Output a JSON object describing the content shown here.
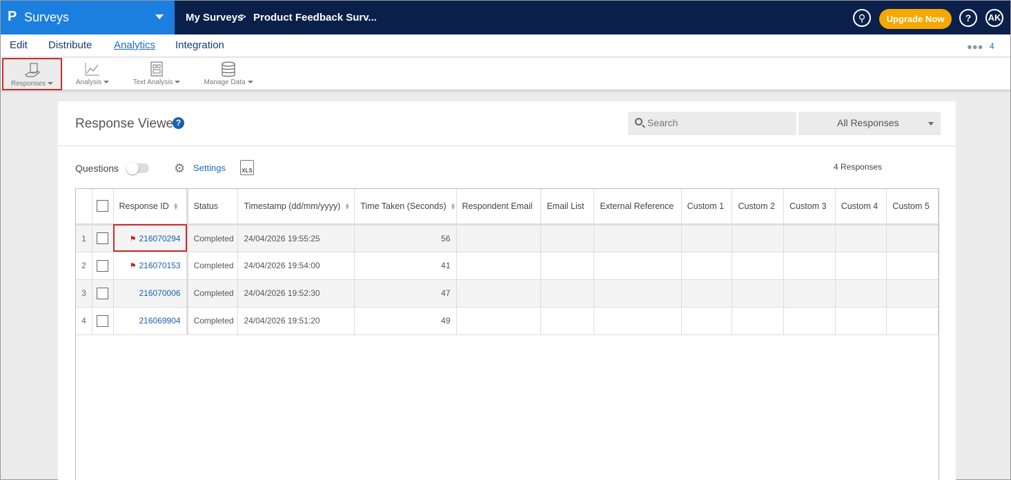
{
  "brand": {
    "logo": "P",
    "name": "Surveys"
  },
  "breadcrumb": {
    "root": "My Surveys",
    "separator": ">",
    "current": "Product Feedback Surv..."
  },
  "header": {
    "search_glyph": "⚲",
    "upgrade_label": "Upgrade Now",
    "help_glyph": "?",
    "avatar_initials": "AK"
  },
  "nav": {
    "tabs": [
      "Edit",
      "Distribute",
      "Analytics",
      "Integration"
    ],
    "active": "Analytics",
    "collaborators_count": "4"
  },
  "ribbon": {
    "tools": [
      {
        "label": "Responses",
        "icon": "hand-document-icon",
        "selected": true
      },
      {
        "label": "Analysis",
        "icon": "line-chart-icon",
        "selected": false
      },
      {
        "label": "Text Analysis",
        "icon": "text-analysis-icon",
        "selected": false
      },
      {
        "label": "Manage Data",
        "icon": "database-icon",
        "selected": false
      }
    ]
  },
  "viewer": {
    "title": "Response Viewer",
    "help": "?",
    "search_placeholder": "Search",
    "filter_value": "All Responses",
    "questions_label": "Questions",
    "questions_toggle_on": false,
    "settings_label": "Settings",
    "export_label": "XLS",
    "responses_count_label": "4 Responses"
  },
  "table": {
    "columns": [
      "Response ID",
      "Status",
      "Timestamp (dd/mm/yyyy)",
      "Time Taken (Seconds)",
      "Respondent Email",
      "Email List",
      "External Reference",
      "Custom 1",
      "Custom 2",
      "Custom 3",
      "Custom 4",
      "Custom 5"
    ],
    "rows": [
      {
        "num": "1",
        "flagged": true,
        "id": "216070294",
        "status": "Completed",
        "timestamp": "24/04/2026 19:55:25",
        "time_taken": "56"
      },
      {
        "num": "2",
        "flagged": true,
        "id": "216070153",
        "status": "Completed",
        "timestamp": "24/04/2026 19:54:00",
        "time_taken": "41"
      },
      {
        "num": "3",
        "flagged": false,
        "id": "216070006",
        "status": "Completed",
        "timestamp": "24/04/2026 19:52:30",
        "time_taken": "47"
      },
      {
        "num": "4",
        "flagged": false,
        "id": "216069904",
        "status": "Completed",
        "timestamp": "24/04/2026 19:51:20",
        "time_taken": "49"
      }
    ]
  },
  "colors": {
    "brand_blue": "#1b7fe0",
    "topbar_navy": "#0b1f4b",
    "upgrade_orange": "#f5a800",
    "link_blue": "#1a5fb0",
    "flag_red": "#c81e1e",
    "highlight_red": "#cf2a2a"
  }
}
